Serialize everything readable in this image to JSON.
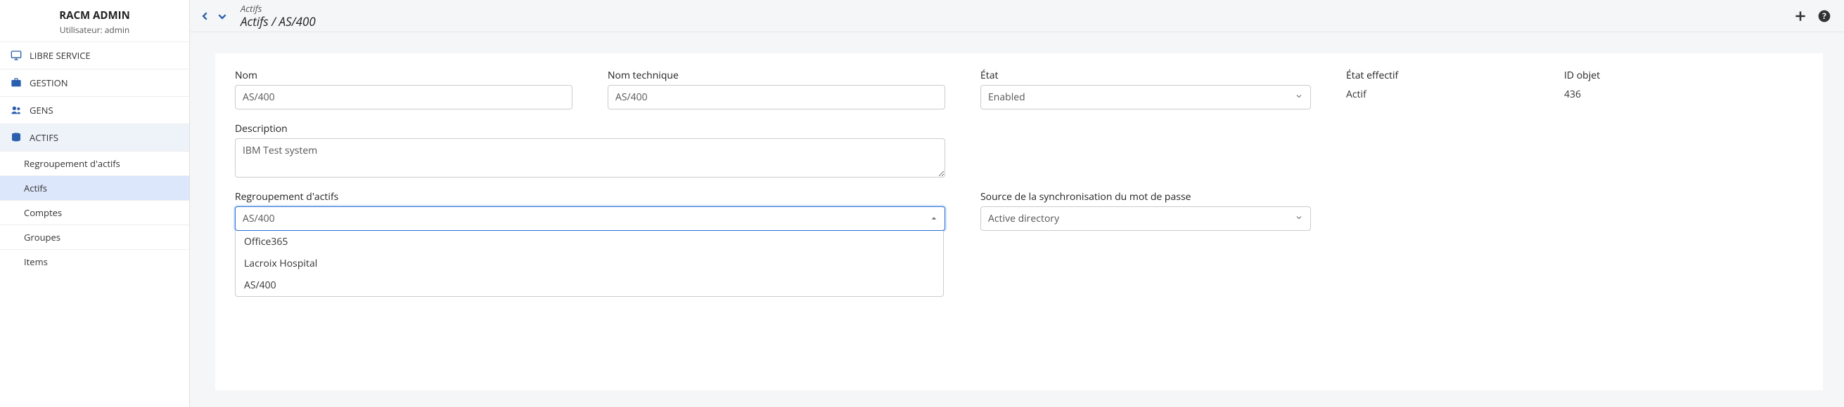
{
  "sidebar": {
    "title": "RACM ADMIN",
    "subtitle": "Utilisateur: admin",
    "sections": {
      "libre_service": "LIBRE SERVICE",
      "gestion": "GESTION",
      "gens": "GENS",
      "actifs": "ACTIFS"
    },
    "actifs_sub": {
      "regroupement": "Regroupement d'actifs",
      "actifs": "Actifs",
      "comptes": "Comptes",
      "groupes": "Groupes",
      "items": "Items"
    }
  },
  "breadcrumb": {
    "top": "Actifs",
    "main": "Actifs / AS/400"
  },
  "form": {
    "nom_label": "Nom",
    "nom_value": "AS/400",
    "nom_technique_label": "Nom technique",
    "nom_technique_value": "AS/400",
    "etat_label": "État",
    "etat_value": "Enabled",
    "etat_effectif_label": "État effectif",
    "etat_effectif_value": "Actif",
    "id_objet_label": "ID objet",
    "id_objet_value": "436",
    "description_label": "Description",
    "description_value": "IBM Test system",
    "regroupement_label": "Regroupement d'actifs",
    "regroupement_value": "AS/400",
    "regroupement_options": [
      "Office365",
      "Lacroix Hospital",
      "AS/400"
    ],
    "source_sync_label": "Source de la synchronisation du mot de passe",
    "source_sync_value": "Active directory"
  }
}
